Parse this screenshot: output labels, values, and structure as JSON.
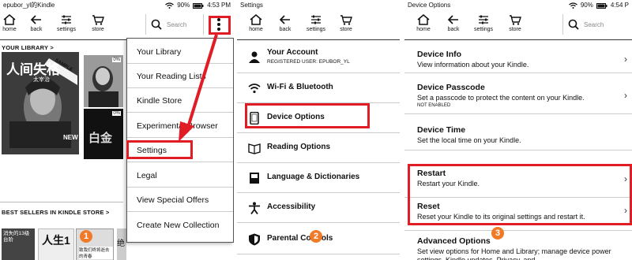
{
  "panel1": {
    "status_title": "epubor_yl的Kindle",
    "battery": "90%",
    "time": "4:53 PM",
    "toolbar": {
      "home": "home",
      "back": "back",
      "settings": "settings",
      "store": "store"
    },
    "search_placeholder": "Search",
    "your_library": "YOUR LIBRARY >",
    "best_sellers": "BEST SELLERS IN KINDLE STORE >",
    "books": {
      "b1_title": "人间失格",
      "b1_author": "太宰治",
      "b1_tag": "SAMPLE",
      "b2_badge": "0%",
      "b3_badge": "0%",
      "b3_title": "白金",
      "b4_title": "消失的13级台阶",
      "b5_title": "人生1",
      "b5_sub": "致我们终将逝去的青春",
      "b6_title": "绝",
      "new_tag": "NEW"
    },
    "menu": [
      "Your Library",
      "Your Reading Lists",
      "Kindle Store",
      "Experimental Browser",
      "Settings",
      "Legal",
      "View Special Offers",
      "Create New Collection"
    ],
    "step_badge": "1"
  },
  "panel2": {
    "status_title": "Settings",
    "toolbar": {
      "home": "home",
      "back": "back",
      "settings": "settings",
      "store": "store"
    },
    "items": [
      {
        "label": "Your Account",
        "sub": "REGISTERED USER: EPUBOR_YL",
        "icon": "person-icon"
      },
      {
        "label": "Wi-Fi & Bluetooth",
        "icon": "wifi-icon"
      },
      {
        "label": "Device Options",
        "icon": "device-icon"
      },
      {
        "label": "Reading Options",
        "icon": "book-open-icon"
      },
      {
        "label": "Language & Dictionaries",
        "icon": "dictionary-icon"
      },
      {
        "label": "Accessibility",
        "icon": "accessibility-icon"
      },
      {
        "label": "Parental Controls",
        "icon": "shield-icon"
      }
    ],
    "step_badge": "2"
  },
  "panel3": {
    "status_title": "Device Options",
    "battery": "90%",
    "time": "4:54 P",
    "toolbar": {
      "home": "home",
      "back": "back",
      "settings": "settings",
      "store": "store"
    },
    "search_placeholder": "Search",
    "options": [
      {
        "title": "Device Info",
        "desc": "View information about your Kindle."
      },
      {
        "title": "Device Passcode",
        "desc": "Set a passcode to protect the content on your Kindle.",
        "note": "NOT ENABLED"
      },
      {
        "title": "Device Time",
        "desc": "Set the local time on your Kindle."
      },
      {
        "title": "Restart",
        "desc": "Restart your Kindle."
      },
      {
        "title": "Reset",
        "desc": "Reset your Kindle to its original settings and restart it."
      },
      {
        "title": "Advanced Options",
        "desc": "Set view options for Home and Library; manage device power settings, Kindle updates, Privacy, and"
      }
    ],
    "step_badge": "3"
  },
  "colors": {
    "highlight": "#e01d24",
    "badge": "#f07a27"
  }
}
